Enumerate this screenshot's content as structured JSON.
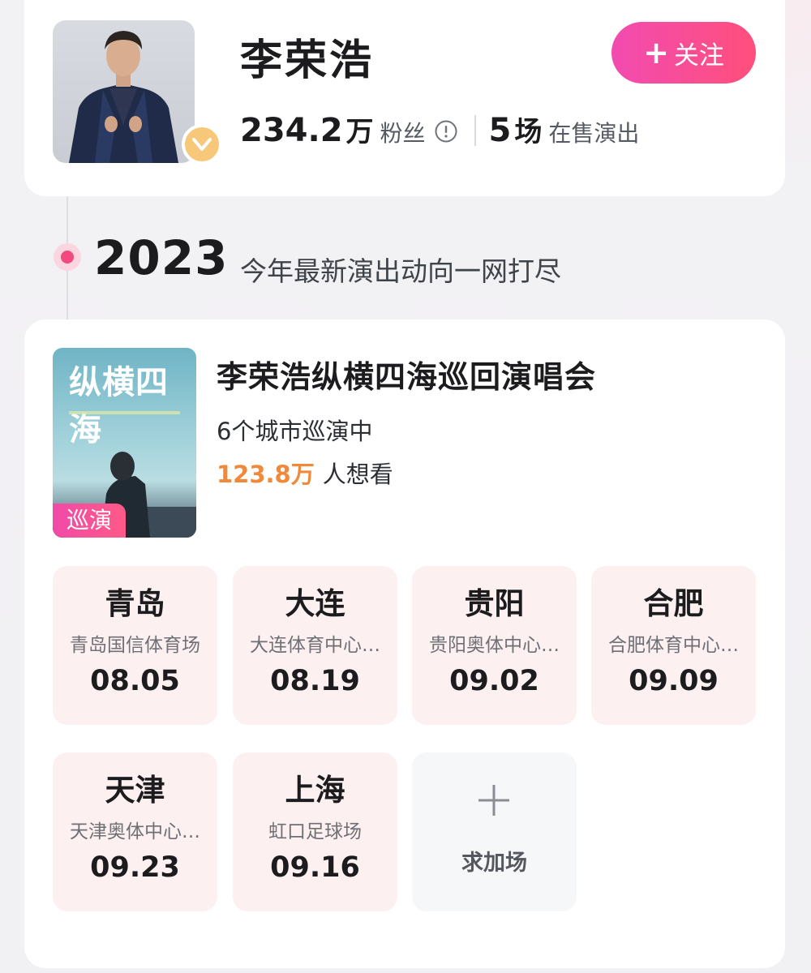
{
  "artist": {
    "name": "李荣浩",
    "fans_count": "234.2",
    "fans_unit": "万",
    "fans_label": "粉丝",
    "shows_count": "5",
    "shows_unit": "场",
    "shows_label": "在售演出",
    "follow_label": "关注"
  },
  "timeline": {
    "year": "2023",
    "subtitle": "今年最新演出动向一网打尽"
  },
  "event": {
    "poster_title": "纵横四海",
    "poster_tag": "巡演",
    "title": "李荣浩纵横四海巡回演唱会",
    "cities_text": "6个城市巡演中",
    "wants_count": "123.8万",
    "wants_label": "人想看",
    "shows": [
      {
        "city": "青岛",
        "venue": "青岛国信体育场",
        "date": "08.05"
      },
      {
        "city": "大连",
        "venue": "大连体育中心…",
        "date": "08.19"
      },
      {
        "city": "贵阳",
        "venue": "贵阳奥体中心…",
        "date": "09.02"
      },
      {
        "city": "合肥",
        "venue": "合肥体育中心…",
        "date": "09.09"
      },
      {
        "city": "天津",
        "venue": "天津奥体中心…",
        "date": "09.23"
      },
      {
        "city": "上海",
        "venue": "虹口足球场",
        "date": "09.16"
      }
    ],
    "add_show_label": "求加场"
  },
  "colors": {
    "accent_pink": "#f2497e",
    "follow_gradient_start": "#f24bb0",
    "follow_gradient_end": "#ff4f7c",
    "wants_orange": "#f08a3a",
    "verified_gold": "#f7c77a",
    "tile_pink": "#fdf0f1"
  },
  "icons": {
    "verified": "verified-v-icon",
    "info": "info-circle-icon",
    "follow": "plus-icon",
    "add_show": "plus-icon"
  }
}
